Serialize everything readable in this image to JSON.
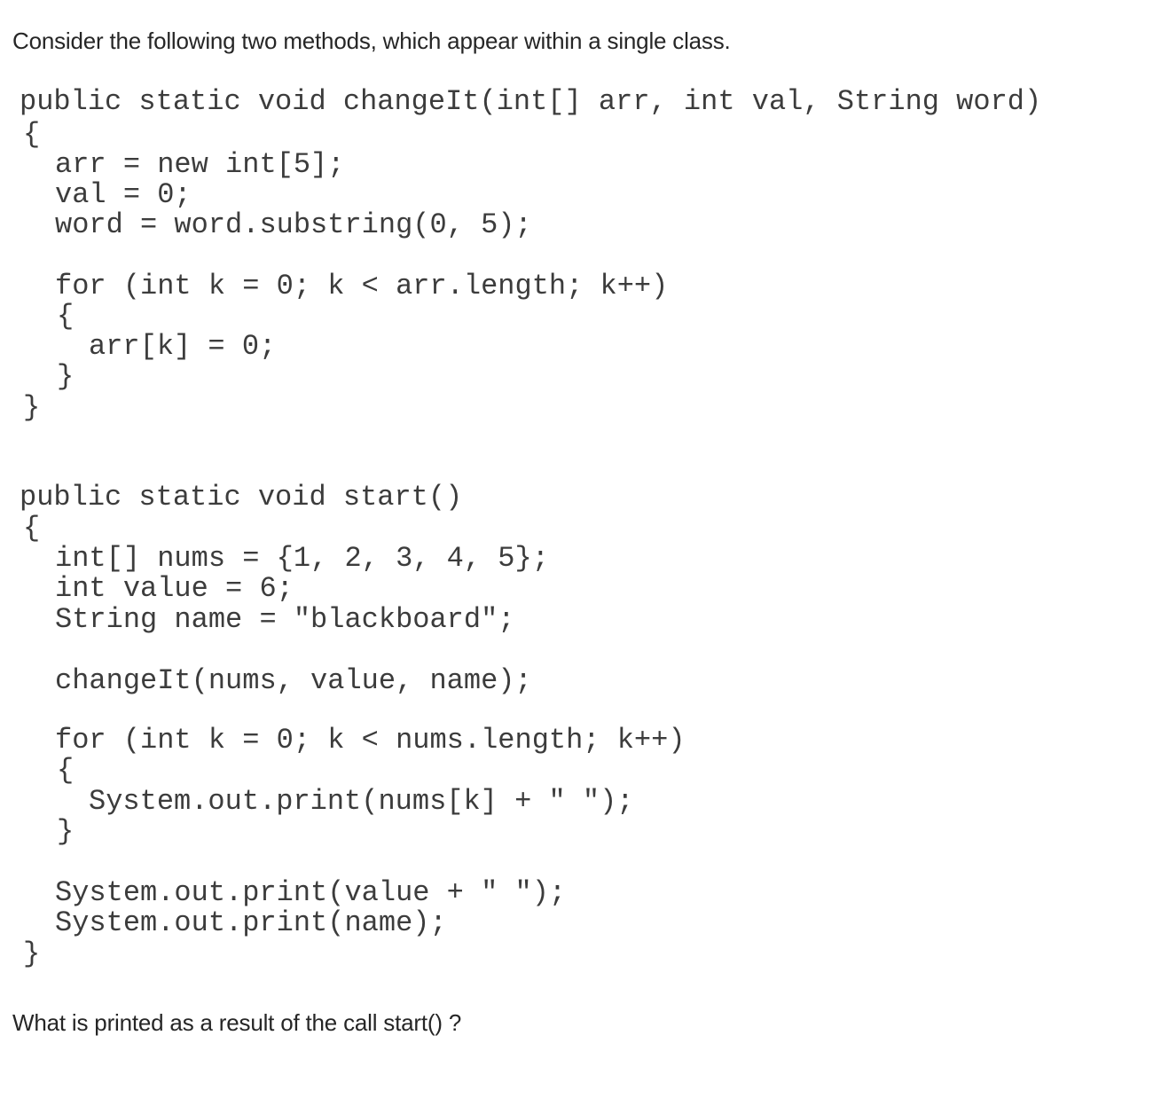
{
  "intro": "Consider the following two methods, which appear within a single class.",
  "code": {
    "change_it_method": [
      "public static void changeIt(int[] arr, int val, String word)",
      "{",
      "arr = new int[5];",
      "val = 0;",
      "word = word.substring(0, 5);",
      "for (int k = 0; k < arr.length; k++)",
      "{",
      "arr[k] = 0;",
      "}",
      "}"
    ],
    "start_method": [
      "public static void start()",
      "{",
      "int[] nums = {1, 2, 3, 4, 5};",
      "int value = 6;",
      "String name = \"blackboard\";",
      "changeIt(nums, value, name);",
      "for (int k = 0; k < nums.length; k++)",
      "{",
      "System.out.print(nums[k] + \" \");",
      "}",
      "System.out.print(value + \" \");",
      "System.out.print(name);",
      "}"
    ]
  },
  "question": "What is printed as a result of the call start() ?"
}
